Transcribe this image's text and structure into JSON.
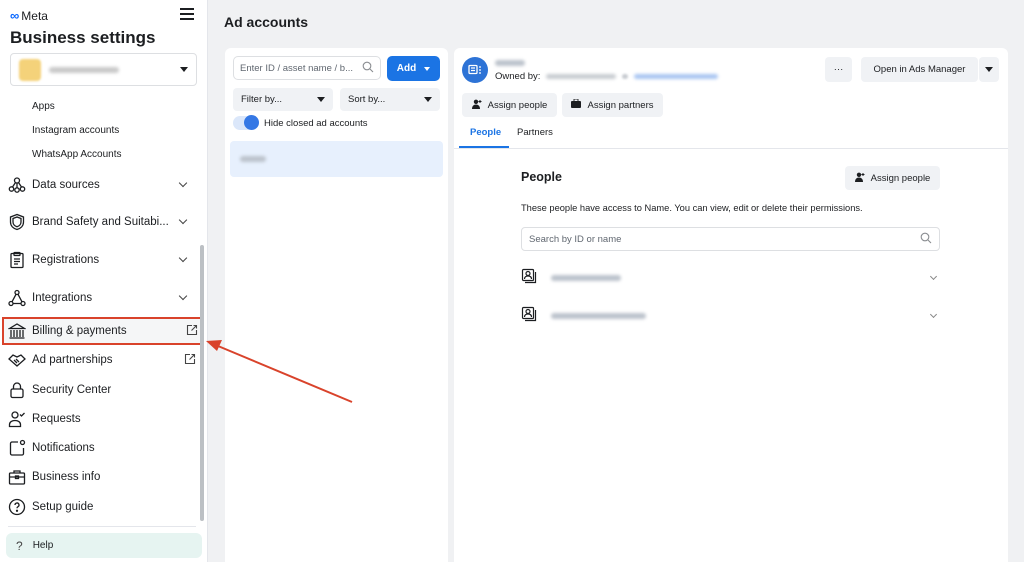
{
  "sidebar": {
    "brand": "Meta",
    "title": "Business settings",
    "business_selector": {
      "name": "[blurred business name]"
    },
    "sub_items": [
      {
        "label": "Apps"
      },
      {
        "label": "Instagram accounts"
      },
      {
        "label": "WhatsApp Accounts"
      }
    ],
    "items": [
      {
        "label": "Data sources",
        "icon": "data-sources-icon",
        "expandable": true
      },
      {
        "label": "Brand Safety and Suitabi...",
        "icon": "shield-icon",
        "expandable": true
      },
      {
        "label": "Registrations",
        "icon": "clipboard-icon",
        "expandable": true
      },
      {
        "label": "Integrations",
        "icon": "integrations-icon",
        "expandable": true
      },
      {
        "label": "Billing & payments",
        "icon": "bank-icon",
        "external": true,
        "highlighted": true
      },
      {
        "label": "Ad partnerships",
        "icon": "handshake-icon",
        "external": true
      },
      {
        "label": "Security Center",
        "icon": "lock-icon"
      },
      {
        "label": "Requests",
        "icon": "person-check-icon"
      },
      {
        "label": "Notifications",
        "icon": "notification-icon"
      },
      {
        "label": "Business info",
        "icon": "briefcase-icon"
      },
      {
        "label": "Setup guide",
        "icon": "question-circle-icon"
      }
    ],
    "help_label": "Help"
  },
  "ad_accounts": {
    "title": "Ad accounts",
    "search_placeholder": "Enter ID / asset name / b...",
    "add_label": "Add",
    "filter_label": "Filter by...",
    "sort_label": "Sort by...",
    "toggle_label": "Hide closed ad accounts",
    "toggle_on": true,
    "selected_account": "[blurred: Name]"
  },
  "detail": {
    "account_name": "[blurred: Name]",
    "owned_by_label": "Owned by:",
    "more_label": "···",
    "open_ads_manager_label": "Open in Ads Manager",
    "assign_people_label": "Assign people",
    "assign_partners_label": "Assign partners",
    "tabs": [
      {
        "label": "People",
        "active": true
      },
      {
        "label": "Partners",
        "active": false
      }
    ],
    "people": {
      "title": "People",
      "assign_label": "Assign people",
      "description": "These people have access to Name. You can view, edit or delete their permissions.",
      "search_placeholder": "Search by ID or name",
      "rows": [
        {
          "name": "[blurred person 1]"
        },
        {
          "name": "[blurred person 2]"
        }
      ]
    }
  },
  "colors": {
    "accent": "#1b74e4",
    "annotation": "#d9432b",
    "help_bg": "#e6f4f1"
  }
}
